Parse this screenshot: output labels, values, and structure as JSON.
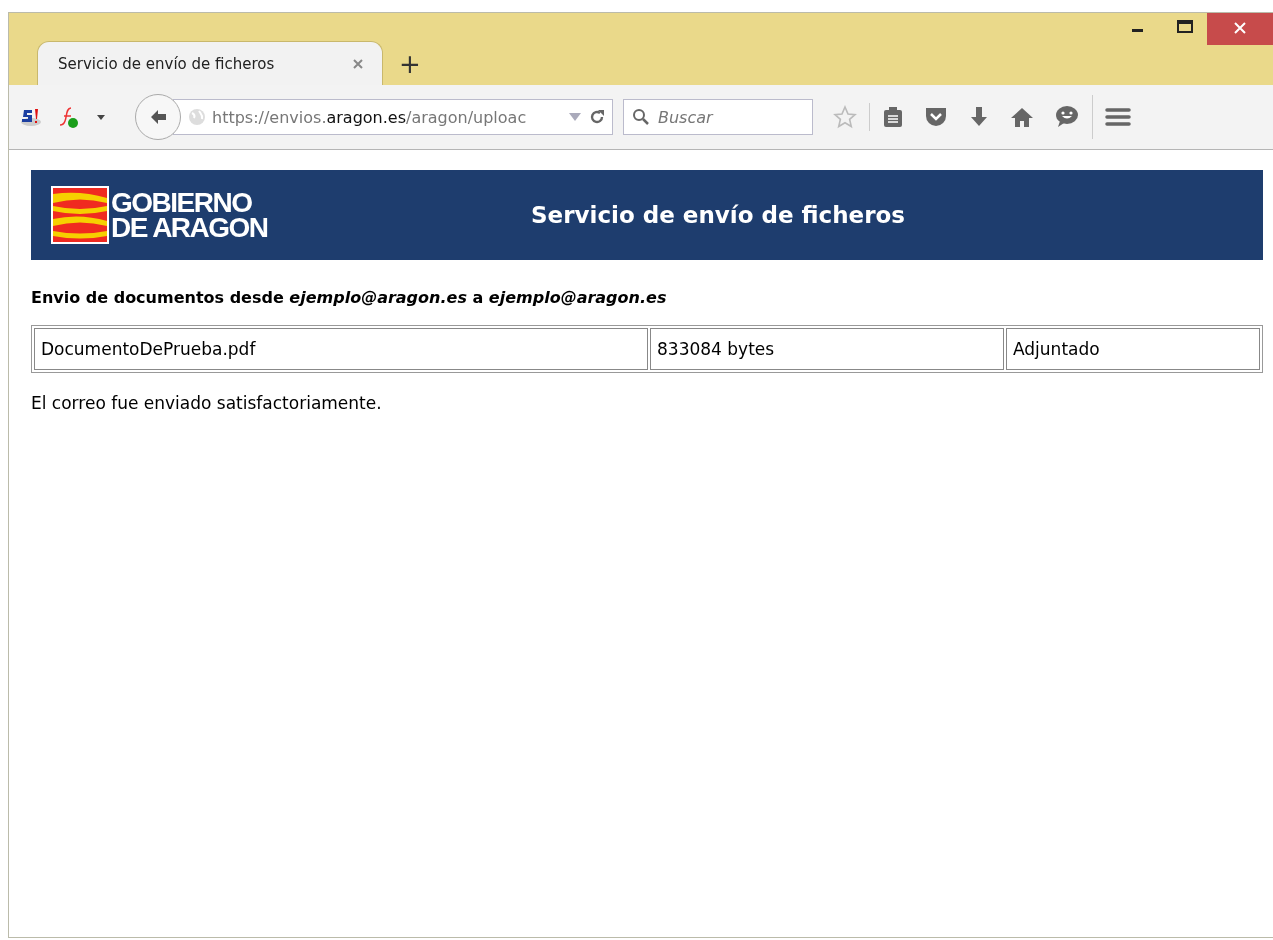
{
  "tab": {
    "title": "Servicio de envío de ficheros",
    "selected": true
  },
  "new_tab": "+",
  "address_bar": {
    "url": "https://envios.**aragon.es**/aragon/uploac"
  },
  "search": {
    "placeholder": "Buscar"
  },
  "header": {
    "logo_lines": [
      "GOBIERNO",
      "DE ARAGON"
    ],
    "title": "Servicio de envío de ficheros"
  },
  "heading": "Envio de documentos desde *ejemplo@aragon.es* a *ejemplo@aragon.es*",
  "table": {
    "rows": [
      [
        "DocumentoDePrueba.pdf",
        "833084 bytes",
        "Adjuntado"
      ]
    ]
  },
  "message": "El correo fue enviado satisfactoriamente."
}
